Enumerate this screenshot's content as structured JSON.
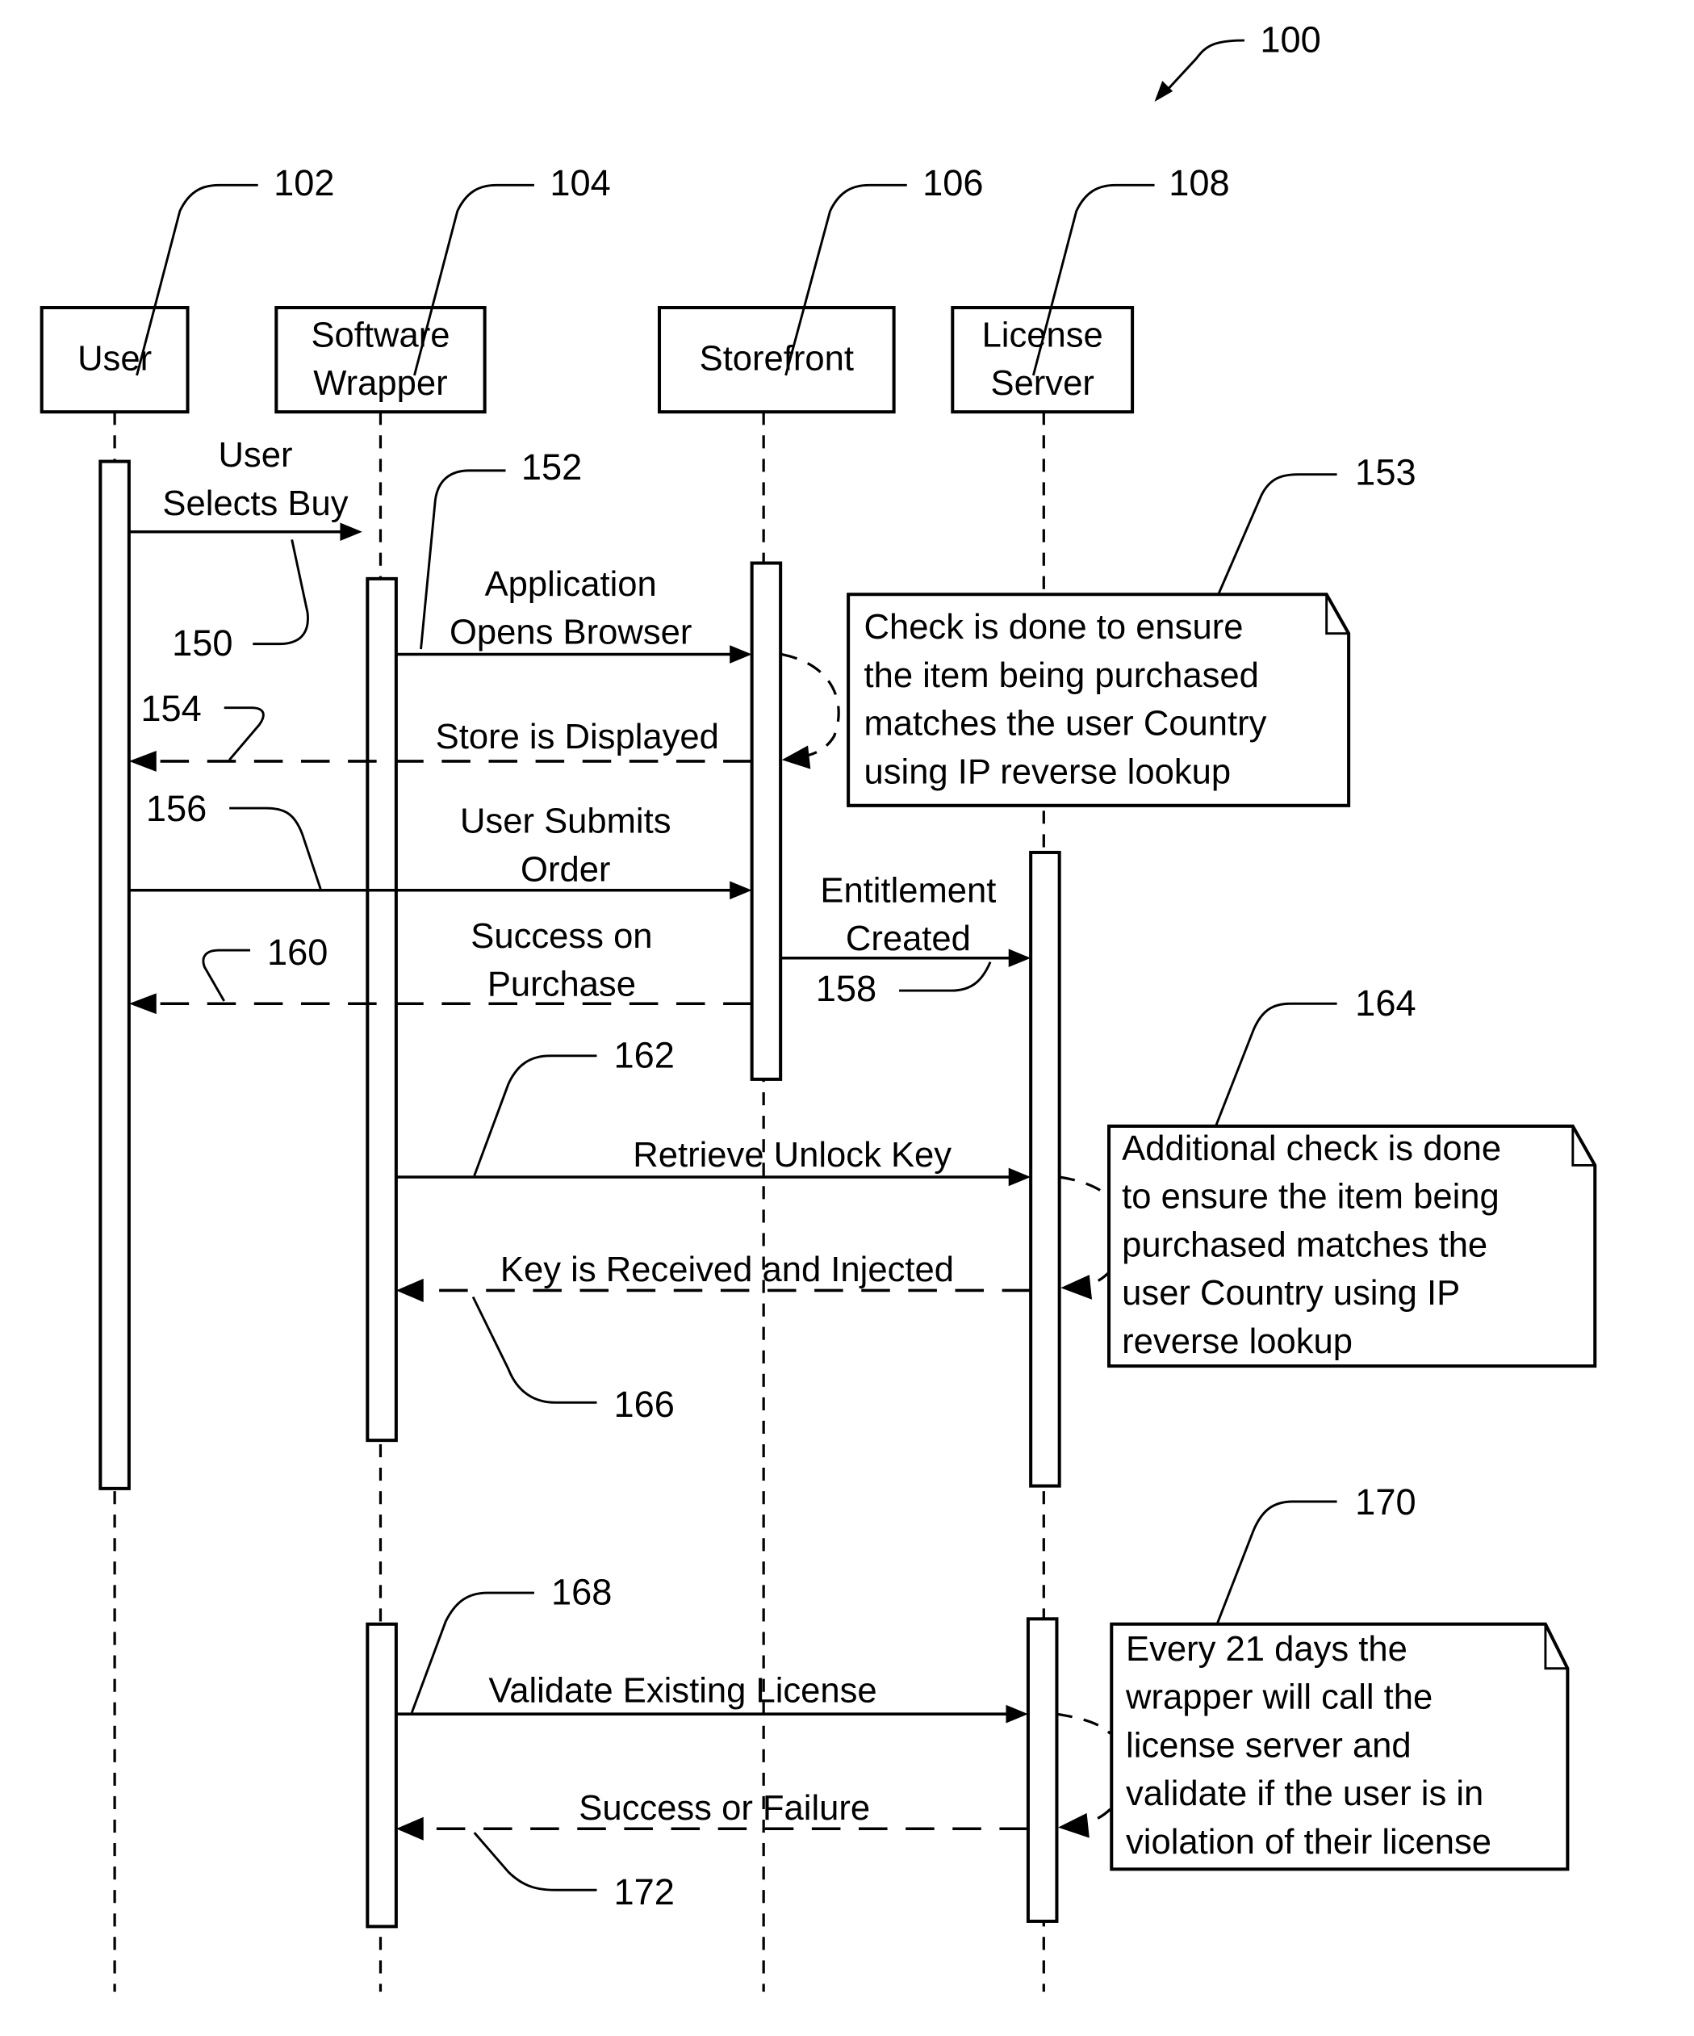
{
  "figure": {
    "ref": "100",
    "colors": {
      "ink": "#000000",
      "paper": "#ffffff"
    }
  },
  "participants": [
    {
      "id": "user",
      "label_lines": [
        "User"
      ],
      "ref": "102"
    },
    {
      "id": "wrapper",
      "label_lines": [
        "Software",
        "Wrapper"
      ],
      "ref": "104"
    },
    {
      "id": "storefront",
      "label_lines": [
        "Storefront"
      ],
      "ref": "106"
    },
    {
      "id": "license",
      "label_lines": [
        "License",
        "Server"
      ],
      "ref": "108"
    }
  ],
  "messages": [
    {
      "id": "m150",
      "from": "user",
      "to": "wrapper",
      "type": "call",
      "label_lines": [
        "User",
        "Selects Buy"
      ],
      "ref": "150"
    },
    {
      "id": "m152",
      "from": "wrapper",
      "to": "storefront",
      "type": "call",
      "label_lines": [
        "Application",
        "Opens Browser"
      ],
      "ref": "152"
    },
    {
      "id": "m154",
      "from": "storefront",
      "to": "user",
      "type": "return",
      "label_lines": [
        "Store is Displayed"
      ],
      "ref": "154"
    },
    {
      "id": "m156",
      "from": "user",
      "to": "storefront",
      "type": "call",
      "label_lines": [
        "User Submits",
        "Order"
      ],
      "ref": "156"
    },
    {
      "id": "m158",
      "from": "storefront",
      "to": "license",
      "type": "call",
      "label_lines": [
        "Entitlement",
        "Created"
      ],
      "ref": "158"
    },
    {
      "id": "m160",
      "from": "storefront",
      "to": "user",
      "type": "return",
      "label_lines": [
        "Success on",
        "Purchase"
      ],
      "ref": "160"
    },
    {
      "id": "m162",
      "from": "wrapper",
      "to": "license",
      "type": "call",
      "label_lines": [
        "Retrieve Unlock Key"
      ],
      "ref": "162"
    },
    {
      "id": "m166",
      "from": "license",
      "to": "wrapper",
      "type": "return",
      "label_lines": [
        "Key is Received and Injected"
      ],
      "ref": "166"
    },
    {
      "id": "m168",
      "from": "wrapper",
      "to": "license",
      "type": "call",
      "label_lines": [
        "Validate Existing License"
      ],
      "ref": "168"
    },
    {
      "id": "m172",
      "from": "license",
      "to": "wrapper",
      "type": "return",
      "label_lines": [
        "Success or Failure"
      ],
      "ref": "172"
    }
  ],
  "notes": [
    {
      "id": "n153",
      "ref": "153",
      "lines": [
        "Check is done to ensure",
        "the item being purchased",
        "matches the user Country",
        "using IP reverse lookup"
      ]
    },
    {
      "id": "n164",
      "ref": "164",
      "lines": [
        "Additional check is done",
        "to ensure the item being",
        "purchased matches the",
        "user Country using IP",
        "reverse lookup"
      ]
    },
    {
      "id": "n170",
      "ref": "170",
      "lines": [
        "Every 21 days the",
        "wrapper will call the",
        "license server and",
        "validate if the user is in",
        "violation of their license"
      ]
    }
  ]
}
